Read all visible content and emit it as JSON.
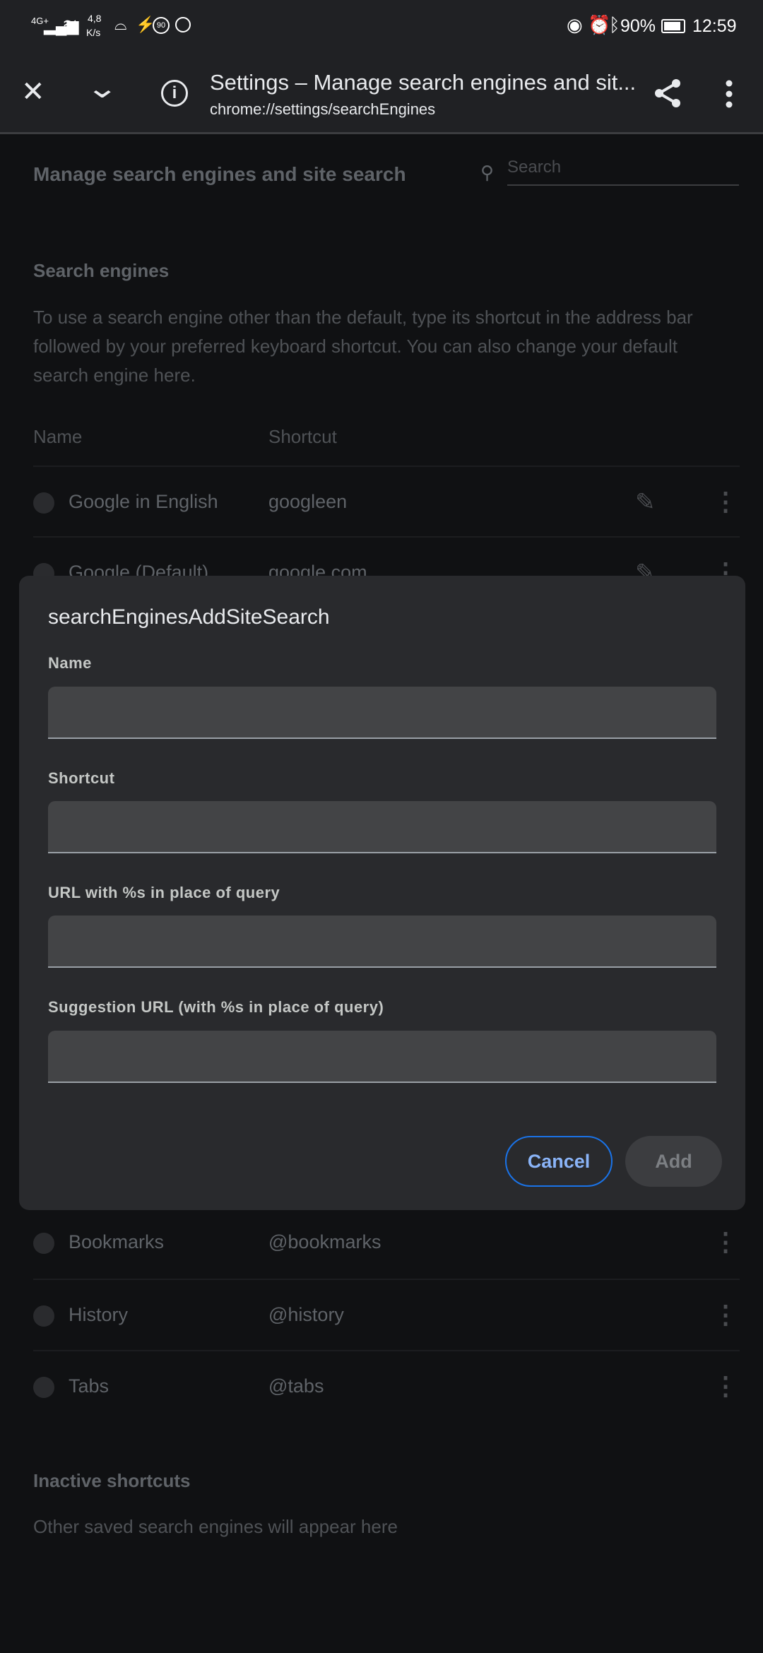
{
  "status_bar": {
    "network": "4G+",
    "speed_value": "4,8",
    "speed_unit": "K/s",
    "battery": "90%",
    "time": "12:59"
  },
  "toolbar": {
    "title": "Settings – Manage search engines and sit...",
    "url": "chrome://settings/searchEngines"
  },
  "page": {
    "title": "Manage search engines and site search",
    "search_placeholder": "Search",
    "section_title": "Search engines",
    "description": "To use a search engine other than the default, type its shortcut in the address bar followed by your preferred keyboard shortcut. You can also change your default search engine here.",
    "col_name": "Name",
    "col_shortcut": "Shortcut",
    "engines": [
      {
        "name": "Google in English",
        "shortcut": "googleen"
      },
      {
        "name": "Google (Default)",
        "shortcut": "google.com"
      }
    ],
    "site_search": [
      {
        "name": "Bookmarks",
        "shortcut": "@bookmarks"
      },
      {
        "name": "History",
        "shortcut": "@history"
      },
      {
        "name": "Tabs",
        "shortcut": "@tabs"
      }
    ],
    "inactive_title": "Inactive shortcuts",
    "inactive_text": "Other saved search engines will appear here"
  },
  "dialog": {
    "title": "searchEnginesAddSiteSearch",
    "fields": [
      {
        "label": "Name",
        "value": ""
      },
      {
        "label": "Shortcut",
        "value": ""
      },
      {
        "label": "URL with %s in place of query",
        "value": ""
      },
      {
        "label": "Suggestion URL (with %s in place of query)",
        "value": ""
      }
    ],
    "cancel": "Cancel",
    "add": "Add"
  },
  "colors": {
    "accent": "#8ab4f8",
    "cancel_border": "#1a73e8"
  }
}
